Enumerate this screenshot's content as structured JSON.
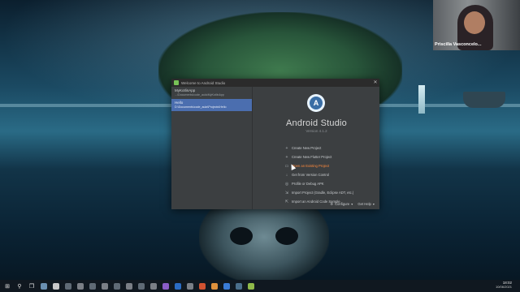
{
  "webcam": {
    "name": "Priscilla Vasconcelo..."
  },
  "window": {
    "title": "Welcome to Android Studio",
    "recent_projects": [
      {
        "name": "MyKotlinApp",
        "path": "...\\Documents\\code_aula\\MyKotlinApp"
      },
      {
        "name": "Hello",
        "path": "D:\\Documents\\code_aula\\Projects\\Hello"
      }
    ],
    "app_title": "Android Studio",
    "version": "Version 4.1.2",
    "actions": [
      {
        "icon": "plus-icon",
        "label": "Create New Project"
      },
      {
        "icon": "plus-icon",
        "label": "Create New Flutter Project"
      },
      {
        "icon": "folder-icon",
        "label": "Open an Existing Project"
      },
      {
        "icon": "download-icon",
        "label": "Get from Version Control"
      },
      {
        "icon": "profile-icon",
        "label": "Profile or Debug APK"
      },
      {
        "icon": "import-icon",
        "label": "Import Project (Gradle, Eclipse ADT, etc.)"
      },
      {
        "icon": "import-sample-icon",
        "label": "Import an Android Code Sample"
      }
    ],
    "configure": "Configure",
    "get_help": "Get Help"
  },
  "taskbar": {
    "time": "18:02",
    "date": "10/06/2021"
  },
  "colors": {
    "accent": "#4b6eaf",
    "active_link": "#ff8a3d"
  }
}
